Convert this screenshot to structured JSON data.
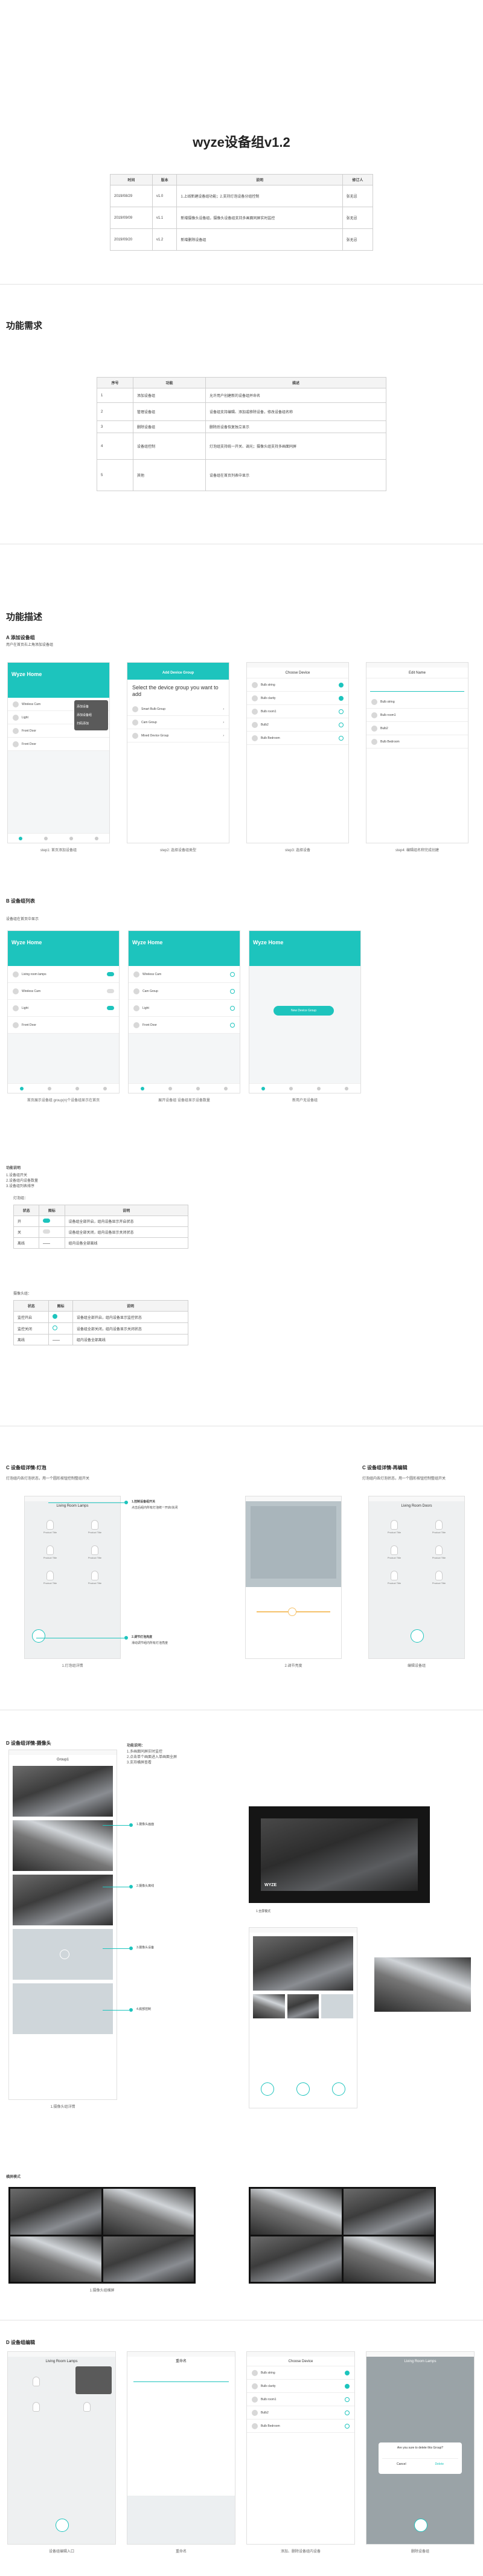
{
  "doc": {
    "title": "wyze设备组v1.2"
  },
  "version_table": {
    "headers": [
      "时间",
      "版本",
      "说明",
      "修订人"
    ],
    "rows": [
      [
        "2019/08/29",
        "v1.0",
        "1.上线新建设备组功能；2.支持灯泡设备分组控制",
        "张无忌"
      ],
      [
        "2019/09/09",
        "v1.1",
        "新增摄像头设备组，摄像头设备组支持多画面同屏实时监控",
        "张无忌"
      ],
      [
        "2019/09/20",
        "v1.2",
        "新增删除设备组",
        "张无忌"
      ]
    ]
  },
  "section1": {
    "title": "功能需求"
  },
  "req_table": {
    "headers": [
      "序号",
      "功能",
      "描述"
    ],
    "rows": [
      [
        "1",
        "添加设备组",
        "允许用户创建新的设备组并命名"
      ],
      [
        "2",
        "管理设备组",
        "设备组支持编辑、添加或移除设备，修改设备组名称"
      ],
      [
        "3",
        "删除设备组",
        "删除后设备恢复独立显示"
      ],
      [
        "4",
        "设备组控制",
        "灯泡组支持统一开关、调光；摄像头组支持多画面同屏"
      ],
      [
        "5",
        "其他",
        "设备组在首页列表中显示"
      ]
    ]
  },
  "section2": {
    "title": "功能描述"
  },
  "A": {
    "title": "A 添加设备组",
    "desc": "用户在首页右上角添加设备组",
    "screens": [
      {
        "header": "Wyze Home",
        "rows": [
          "Wireless Cam",
          "Light",
          "Front Door",
          "Front Door"
        ],
        "menu": [
          "添加设备",
          "添加设备组",
          "扫码添加"
        ],
        "caption": "step1: 首页添加设备组"
      },
      {
        "top": "Add Device Group",
        "prompt": "Select the device group you want to add",
        "items": [
          "Smart Bulb Group",
          "Cam Group",
          "Mixed Device Group"
        ],
        "caption": "step2: 选择设备组类型"
      },
      {
        "top": "Choose Device",
        "items": [
          "Bulb string",
          "Bulb clarity",
          "Bulb room1",
          "Bulb2",
          "Bulb Bedroom"
        ],
        "caption": "step3: 选择设备"
      },
      {
        "top": "Edit Name",
        "items": [
          "Bulb string",
          "Bulb room1",
          "Bulb2",
          "Bulb Bedroom"
        ],
        "caption": "step4: 编辑组名称完成创建"
      }
    ]
  },
  "B": {
    "title": "B 设备组列表",
    "desc": "设备组在首页中显示",
    "screens": [
      {
        "header": "Wyze Home",
        "rows": [
          "Living room lamps",
          "Wireless Cam",
          "Light",
          "Front Door"
        ],
        "caption": "首页展示设备组 group(n)个设备组显示在首页"
      },
      {
        "header": "Wyze Home",
        "rows": [
          "Wireless Cam",
          "Cam Group",
          "Light",
          "Front Door"
        ],
        "caption": "展开设备组 设备组显示设备数量"
      },
      {
        "header": "Wyze Home",
        "button": "New Device Group",
        "caption": "新用户无设备组"
      }
    ]
  },
  "rules": {
    "title": "功能说明",
    "items": [
      "1.设备组开关",
      "2.设备组内设备数量",
      "3.设备组列表排序"
    ],
    "table1_title": "灯泡组：",
    "table1_headers": [
      "状态",
      "图标",
      "说明"
    ],
    "table1_rows": [
      [
        "开",
        "",
        "设备组全部开启，组内设备显示开启状态"
      ],
      [
        "关",
        "",
        "设备组全部关闭，组内设备显示关闭状态"
      ],
      [
        "离线",
        "",
        "组内设备全部离线"
      ]
    ],
    "table2_title": "摄像头组：",
    "table2_headers": [
      "状态",
      "图标",
      "说明"
    ],
    "table2_rows": [
      [
        "监控开启",
        "",
        "设备组全部开启，组内设备显示监控状态"
      ],
      [
        "监控关闭",
        "",
        "设备组全部关闭，组内设备显示关闭状态"
      ],
      [
        "离线",
        "",
        "组内设备全部离线"
      ]
    ]
  },
  "C1": {
    "title": "C 设备组详情-灯泡",
    "desc": "灯泡组内各灯泡状态，用一个圆形按钮控制整组开关",
    "screen_title": "Living Room Lamps",
    "bulb_label": "Product Title",
    "callout1": "1.控制设备组开关",
    "callout1_note": "点击后组内所有灯泡统一开启/关闭",
    "callout2": "2.调节灯泡亮度",
    "callout2_note": "滑动调节组内所有灯泡亮度",
    "caption1": "1.灯泡组详情",
    "caption2": "2.调节亮度"
  },
  "C2": {
    "title": "C 设备组详情-再编辑",
    "desc": "灯泡组内各灯泡状态，用一个圆形按钮控制整组开关",
    "screen_title": "Living Room Doors",
    "bulb_label": "Product Title",
    "caption": "编辑设备组"
  },
  "D": {
    "title": "D 设备组详情-摄像头",
    "desc_title": "功能说明：",
    "desc_lines": [
      "1.多画面同屏实时监控",
      "2.点击单个画面进入单画面全屏",
      "3.支持横屏查看"
    ],
    "screen_title": "Group1",
    "callouts": [
      "1.摄像头画面",
      "2.摄像头离线",
      "3.摄像头设备",
      "4.底部控制"
    ],
    "caption": "1.摄像头组详情",
    "right_label": "1.全屏模式",
    "cam_brand": "WYZE",
    "bottom_label": "横屏模式",
    "bottom_caption": "1.摄像头组横屏"
  },
  "E": {
    "title": "D 设备组编辑",
    "screens": [
      {
        "top": "Living Room Lamps",
        "caption": "设备组编辑入口"
      },
      {
        "top": "重命名",
        "caption": "重命名"
      },
      {
        "top": "Choose Device",
        "items": [
          "Bulb string",
          "Bulb clarity",
          "Bulb room1",
          "Bulb2",
          "Bulb Bedroom"
        ],
        "caption": "添加、删除设备组内设备"
      },
      {
        "top": "Living Room Lamps",
        "dialog": "Are you sure to delete this Group?",
        "cancel": "Cancel",
        "delete": "Delete",
        "caption": "删除设备组"
      }
    ]
  }
}
